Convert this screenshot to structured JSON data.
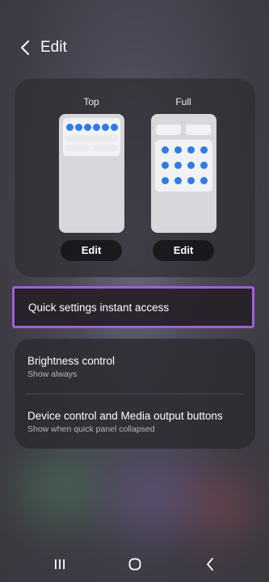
{
  "header": {
    "title": "Edit",
    "back_icon": "chevron-left-icon"
  },
  "layout_options": {
    "top": {
      "label": "Top",
      "edit_label": "Edit"
    },
    "full": {
      "label": "Full",
      "edit_label": "Edit"
    }
  },
  "instant_access": {
    "label": "Quick settings instant access",
    "highlight_color": "#a25ed8"
  },
  "settings": {
    "brightness": {
      "title": "Brightness control",
      "subtitle": "Show always"
    },
    "device_control": {
      "title": "Device control and Media output buttons",
      "subtitle": "Show when quick panel collapsed"
    }
  },
  "navbar": {
    "recents_icon": "recents-icon",
    "home_icon": "home-icon",
    "back_icon": "back-icon"
  },
  "colors": {
    "accent_blue": "#2c7de4",
    "highlight_purple": "#a25ed8"
  }
}
